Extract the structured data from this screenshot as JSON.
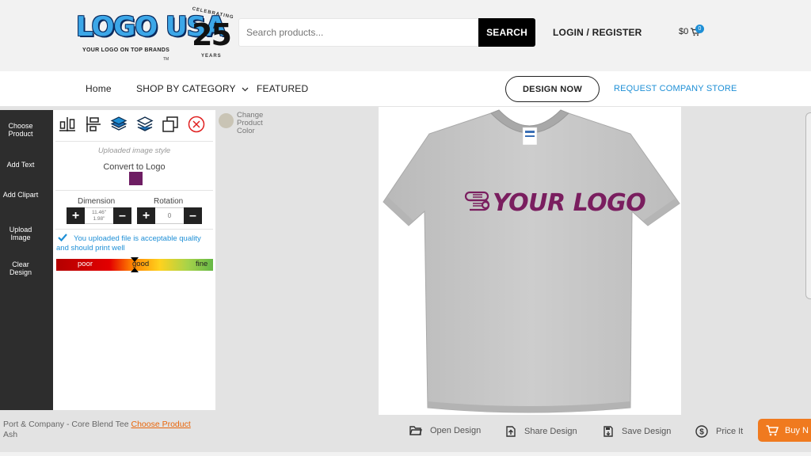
{
  "header": {
    "logo_text": "LOGO USA",
    "logo_tagline": "YOUR LOGO ON TOP BRANDS",
    "logo_tm": "TM",
    "badge_top": "CELEBRATING",
    "badge_number": "25",
    "badge_bottom": "YEARS",
    "search_placeholder": "Search products...",
    "search_button": "SEARCH",
    "login": "LOGIN / REGISTER",
    "cart_amount": "$0",
    "cart_count": "0"
  },
  "nav": {
    "home": "Home",
    "shop": "SHOP BY CATEGORY",
    "featured": "FEATURED",
    "design_now": "DESIGN NOW",
    "request_store": "REQUEST COMPANY STORE"
  },
  "sidebar": {
    "items": [
      {
        "label": "Choose Product"
      },
      {
        "label": "Add Text"
      },
      {
        "label": "Add Clipart"
      },
      {
        "label": "Upload Image"
      },
      {
        "label": "Clear Design"
      }
    ]
  },
  "panel": {
    "style_label": "Uploaded image style",
    "convert_label": "Convert to Logo",
    "swatch_color": "#6e1d63",
    "dimension_label": "Dimension",
    "dimension_w": "11.46\"",
    "dimension_h": "1.98\"",
    "rotation_label": "Rotation",
    "rotation_value": "0",
    "quality_message": "You uploaded file is acceptable quality and should print well",
    "quality_poor": "poor",
    "quality_good": "good",
    "quality_fine": "fine",
    "quality_level_fraction": 0.5
  },
  "product_color": {
    "label": "Change Product Color",
    "swatch": "#c9c4b5"
  },
  "canvas": {
    "design_text": "YOUR LOGO",
    "shirt_color": "#c6c6c6",
    "design_color": "#7a1e5f"
  },
  "bottom": {
    "product_name": "Port & Company - Core Blend Tee",
    "choose_product_link": "Choose Product",
    "product_color": "Ash",
    "open_design": "Open Design",
    "share_design": "Share Design",
    "save_design": "Save Design",
    "price_it": "Price It",
    "buy_now": "Buy N"
  },
  "colors": {
    "accent_blue": "#1e8fd6",
    "accent_orange": "#f07a1f",
    "sidebar_bg": "#2d2d2d"
  }
}
